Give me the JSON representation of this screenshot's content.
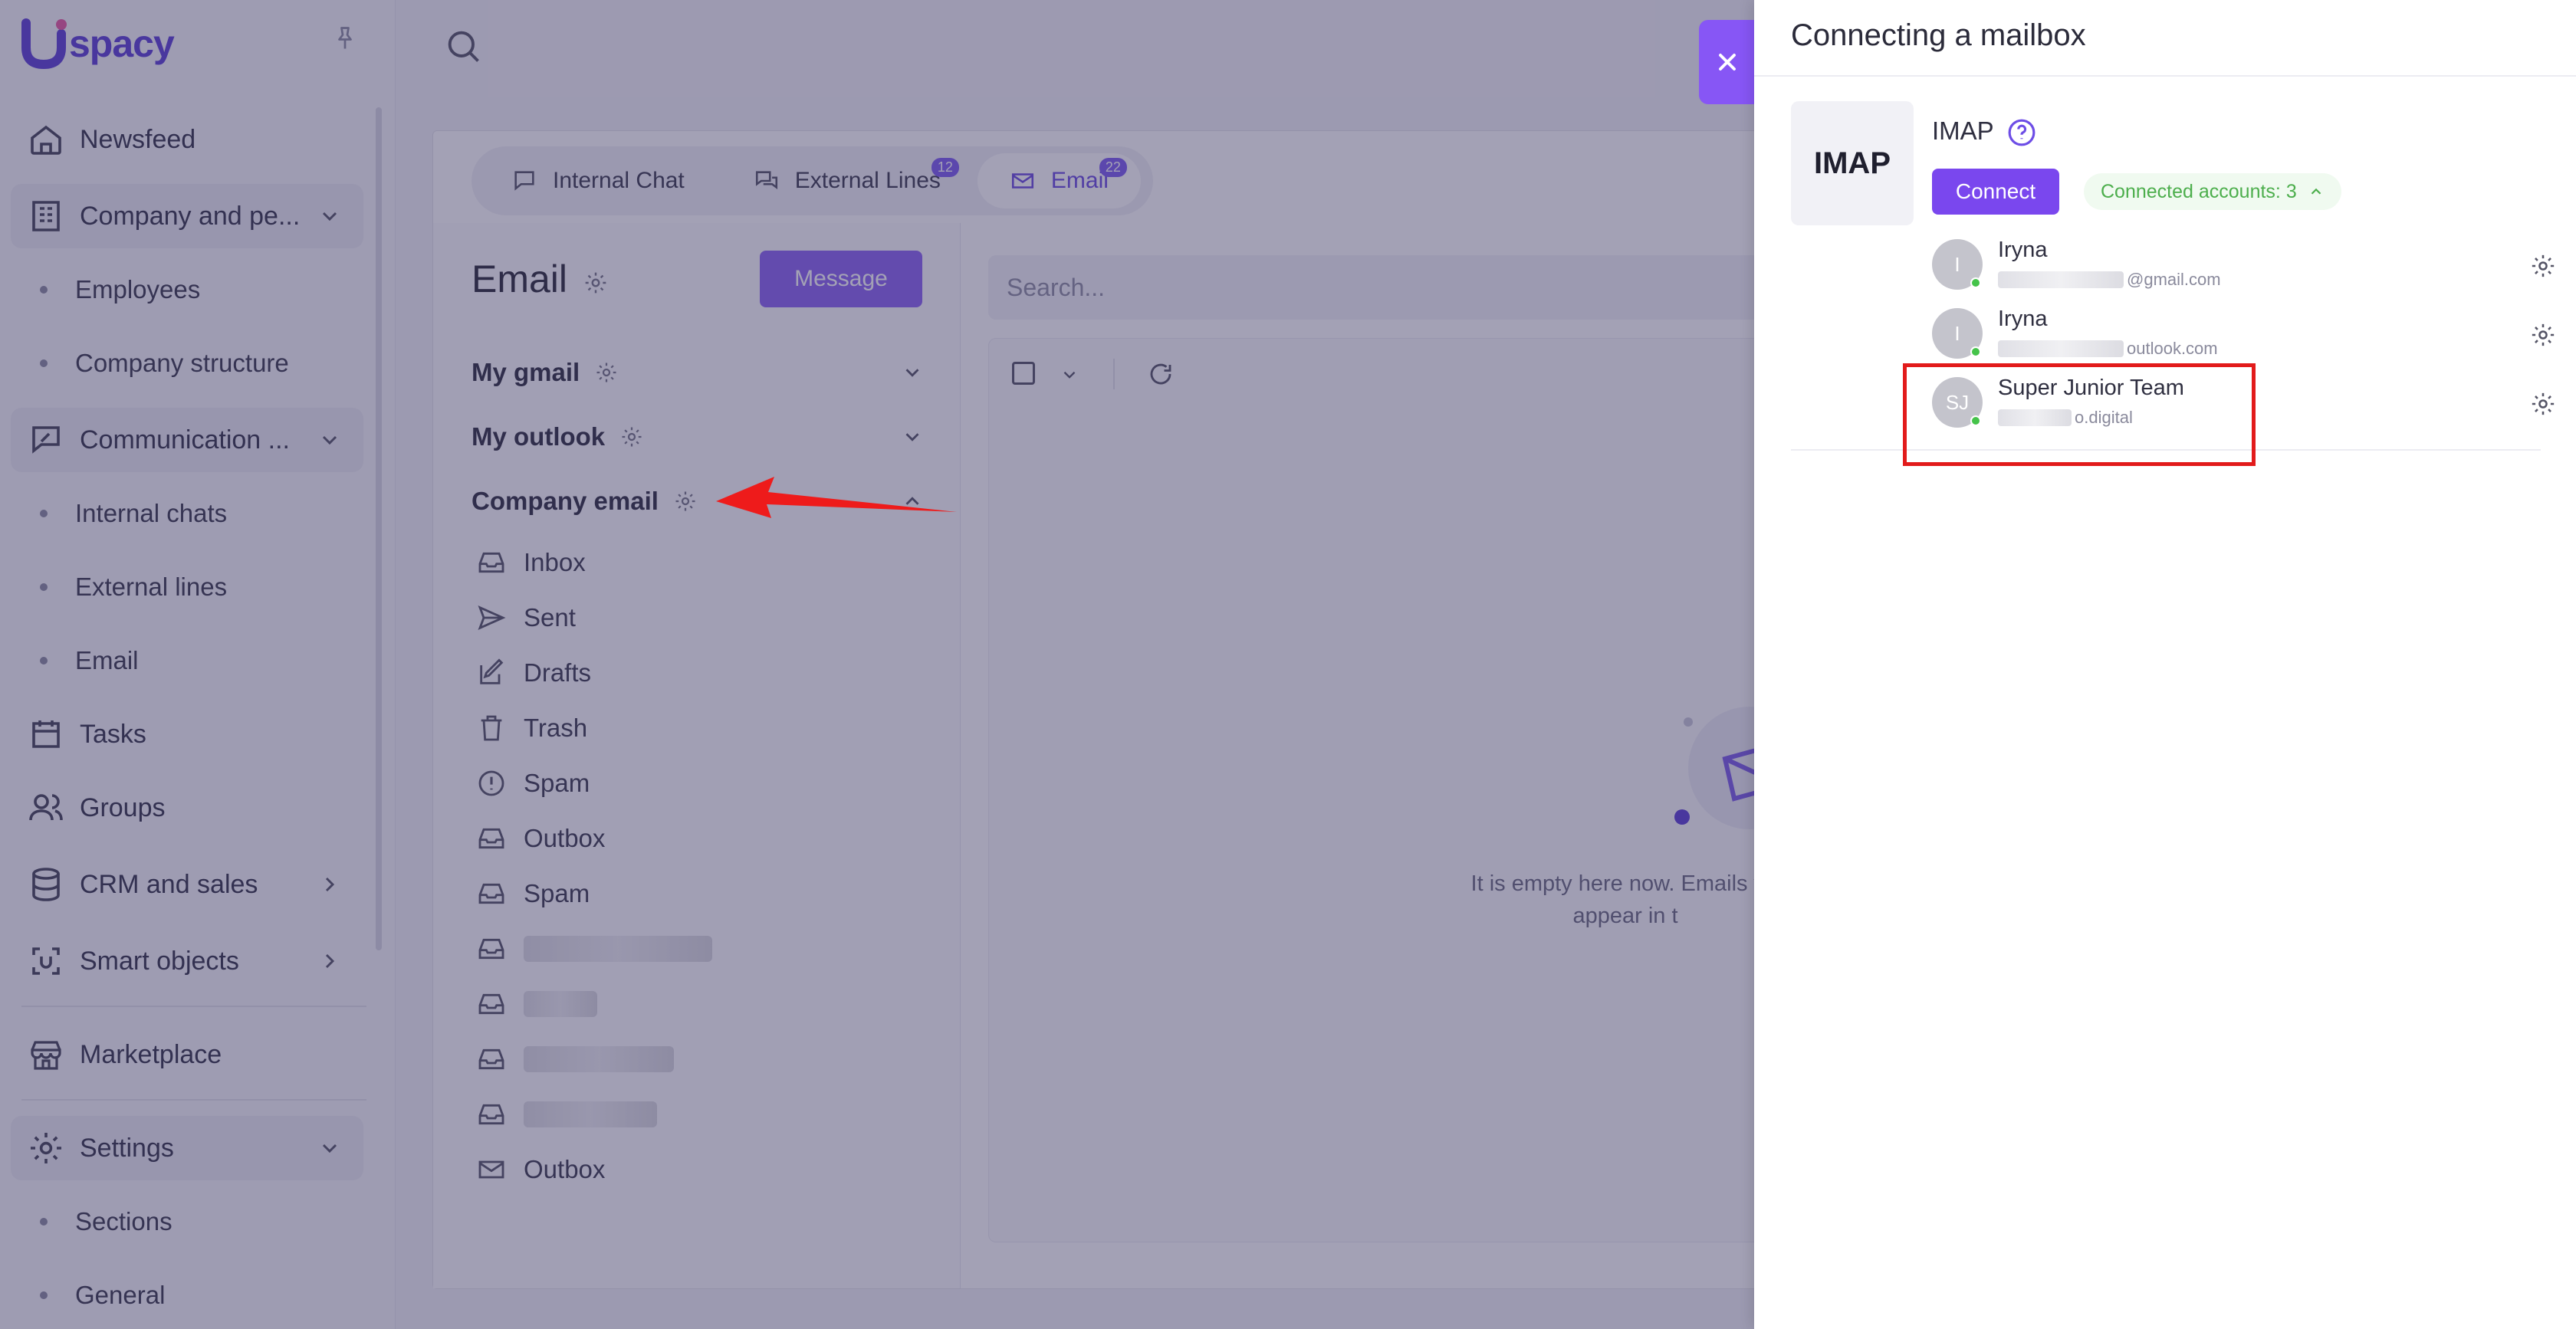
{
  "app": {
    "logo_text": "spacy",
    "brand_color": "#5b3fd6",
    "accent_color": "#7a47ee"
  },
  "sidebar": {
    "items": [
      {
        "type": "item",
        "icon": "home-icon",
        "label": "Newsfeed"
      },
      {
        "type": "section",
        "icon": "building-icon",
        "label": "Company and pe...",
        "chevron": "chevron-down-icon"
      },
      {
        "type": "sub",
        "label": "Employees"
      },
      {
        "type": "sub",
        "label": "Company structure"
      },
      {
        "type": "section",
        "icon": "chat-edit-icon",
        "label": "Communication ...",
        "chevron": "chevron-down-icon"
      },
      {
        "type": "sub",
        "label": "Internal chats"
      },
      {
        "type": "sub",
        "label": "External lines"
      },
      {
        "type": "sub",
        "label": "Email"
      },
      {
        "type": "item",
        "icon": "calendar-icon",
        "label": "Tasks"
      },
      {
        "type": "item",
        "icon": "users-icon",
        "label": "Groups"
      },
      {
        "type": "item",
        "icon": "database-icon",
        "label": "CRM and sales",
        "chevron": "chevron-right-icon"
      },
      {
        "type": "item",
        "icon": "scan-icon",
        "label": "Smart objects",
        "chevron": "chevron-right-icon"
      },
      {
        "type": "item",
        "icon": "store-icon",
        "label": "Marketplace"
      },
      {
        "type": "section",
        "icon": "gear-icon",
        "label": "Settings",
        "chevron": "chevron-down-icon"
      },
      {
        "type": "sub",
        "label": "Sections"
      },
      {
        "type": "sub",
        "label": "General"
      }
    ]
  },
  "tabs": [
    {
      "label": "Internal Chat",
      "icon": "chat-icon",
      "badge": ""
    },
    {
      "label": "External Lines",
      "icon": "chats-icon",
      "badge": "12"
    },
    {
      "label": "Email",
      "icon": "mail-icon",
      "badge": "22",
      "active": true
    }
  ],
  "email": {
    "title": "Email",
    "message_button": "Message",
    "accounts": [
      {
        "label": "My gmail",
        "chevron": "chevron-down-icon"
      },
      {
        "label": "My outlook",
        "chevron": "chevron-down-icon"
      },
      {
        "label": "Company email",
        "chevron": "chevron-up-icon"
      }
    ],
    "folders": [
      {
        "label": "Inbox",
        "icon": "inbox-icon"
      },
      {
        "label": "Sent",
        "icon": "send-icon"
      },
      {
        "label": "Drafts",
        "icon": "edit-icon"
      },
      {
        "label": "Trash",
        "icon": "trash-icon"
      },
      {
        "label": "Spam",
        "icon": "alert-circle-icon"
      },
      {
        "label": "Outbox",
        "icon": "inbox-icon"
      },
      {
        "label": "Spam",
        "icon": "inbox-icon"
      },
      {
        "label": "",
        "icon": "inbox-icon",
        "blurred": true
      },
      {
        "label": "",
        "icon": "inbox-icon",
        "blurred": true
      },
      {
        "label": "",
        "icon": "inbox-icon",
        "blurred": true
      },
      {
        "label": "",
        "icon": "inbox-icon",
        "blurred": true
      },
      {
        "label": "Outbox",
        "icon": "mail-out-icon"
      }
    ],
    "search_placeholder": "Search...",
    "empty_text_line1": "It is empty here now. Emails wil",
    "empty_text_line2": "appear in t"
  },
  "drawer": {
    "title": "Connecting a mailbox",
    "provider_tile": "IMAP",
    "provider_name": "IMAP",
    "connect_label": "Connect",
    "connected_label": "Connected accounts: 3",
    "accounts": [
      {
        "initials": "I",
        "name": "Iryna",
        "email_visible": "@gmail.com"
      },
      {
        "initials": "I",
        "name": "Iryna",
        "email_visible": "outlook.com"
      },
      {
        "initials": "SJ",
        "name": "Super Junior Team",
        "email_visible": "o.digital"
      }
    ]
  }
}
